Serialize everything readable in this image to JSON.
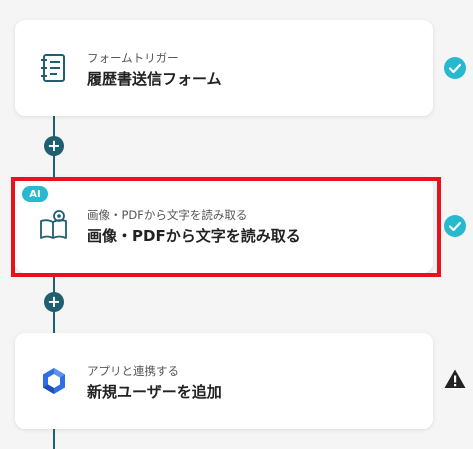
{
  "steps": [
    {
      "subtitle": "フォームトリガー",
      "title": "履歴書送信フォーム",
      "icon": "form-icon",
      "status": "complete"
    },
    {
      "badge": "AI",
      "subtitle": "画像・PDFから文字を読み取る",
      "title": "画像・PDFから文字を読み取る",
      "icon": "ocr-book-icon",
      "status": "complete",
      "selected": true
    },
    {
      "subtitle": "アプリと連携する",
      "title": "新規ユーザーを追加",
      "icon": "app-hexagon-icon",
      "status": "warning"
    }
  ],
  "add_button_label": "+",
  "colors": {
    "connector": "#1f5f70",
    "check": "#27b9cf",
    "warning": "#222222",
    "selection": "#e8131a",
    "ai_badge": "#27b9cf",
    "icon_teal": "#1f5f70",
    "app_blue": "#2f6fe4"
  }
}
